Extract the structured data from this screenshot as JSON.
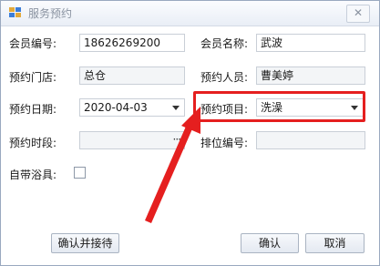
{
  "window": {
    "title": "服务预约",
    "close_label": "✕"
  },
  "form": {
    "member_no": {
      "label": "会员编号:",
      "value": "18626269200"
    },
    "member_name": {
      "label": "会员名称:",
      "value": "武波"
    },
    "store": {
      "label": "预约门店:",
      "value": "总仓"
    },
    "staff": {
      "label": "预约人员:",
      "value": "曹美婷"
    },
    "date": {
      "label": "预约日期:",
      "value": "2020-04-03"
    },
    "item": {
      "label": "预约项目:",
      "value": "洗澡"
    },
    "time_slot": {
      "label": "预约时段:",
      "value": "",
      "button": "···"
    },
    "slot_no": {
      "label": "排位编号:",
      "value": ""
    },
    "own_tools": {
      "label": "自带浴具:",
      "checked": false
    }
  },
  "buttons": {
    "confirm_receive": "确认并接待",
    "confirm": "确认",
    "cancel": "取消"
  },
  "annotation": {
    "color": "#e51f1f"
  }
}
